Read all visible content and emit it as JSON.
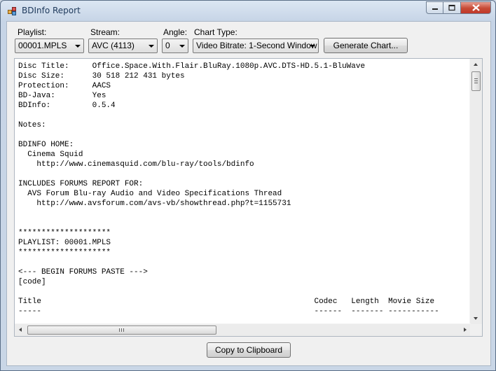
{
  "window": {
    "title": "BDInfo Report"
  },
  "controls": {
    "playlist_label": "Playlist:",
    "playlist_value": "00001.MPLS",
    "stream_label": "Stream:",
    "stream_value": "AVC (4113)",
    "angle_label": "Angle:",
    "angle_value": "0",
    "chart_type_label": "Chart Type:",
    "chart_type_value": "Video Bitrate: 1-Second Window",
    "generate_chart_label": "Generate Chart..."
  },
  "report": {
    "lines": [
      "Disc Title:     Office.Space.With.Flair.BluRay.1080p.AVC.DTS-HD.5.1-BluWave",
      "Disc Size:      30 518 212 431 bytes",
      "Protection:     AACS",
      "BD-Java:        Yes",
      "BDInfo:         0.5.4",
      "",
      "Notes:",
      "",
      "BDINFO HOME:",
      "  Cinema Squid",
      "    http://www.cinemasquid.com/blu-ray/tools/bdinfo",
      "",
      "INCLUDES FORUMS REPORT FOR:",
      "  AVS Forum Blu-ray Audio and Video Specifications Thread",
      "    http://www.avsforum.com/avs-vb/showthread.php?t=1155731",
      "",
      "",
      "********************",
      "PLAYLIST: 00001.MPLS",
      "********************",
      "",
      "<--- BEGIN FORUMS PASTE --->",
      "[code]",
      "",
      "Title                                                           Codec   Length  Movie Size",
      "-----                                                           ------  ------- -----------"
    ]
  },
  "footer": {
    "copy_button_label": "Copy to Clipboard"
  },
  "icons": {
    "app": "bdinfo-app-icon",
    "minimize": "minimize-icon",
    "maximize": "maximize-icon",
    "close": "close-icon"
  },
  "colors": {
    "close_button": "#c74a35",
    "title_text": "#1e395b"
  }
}
